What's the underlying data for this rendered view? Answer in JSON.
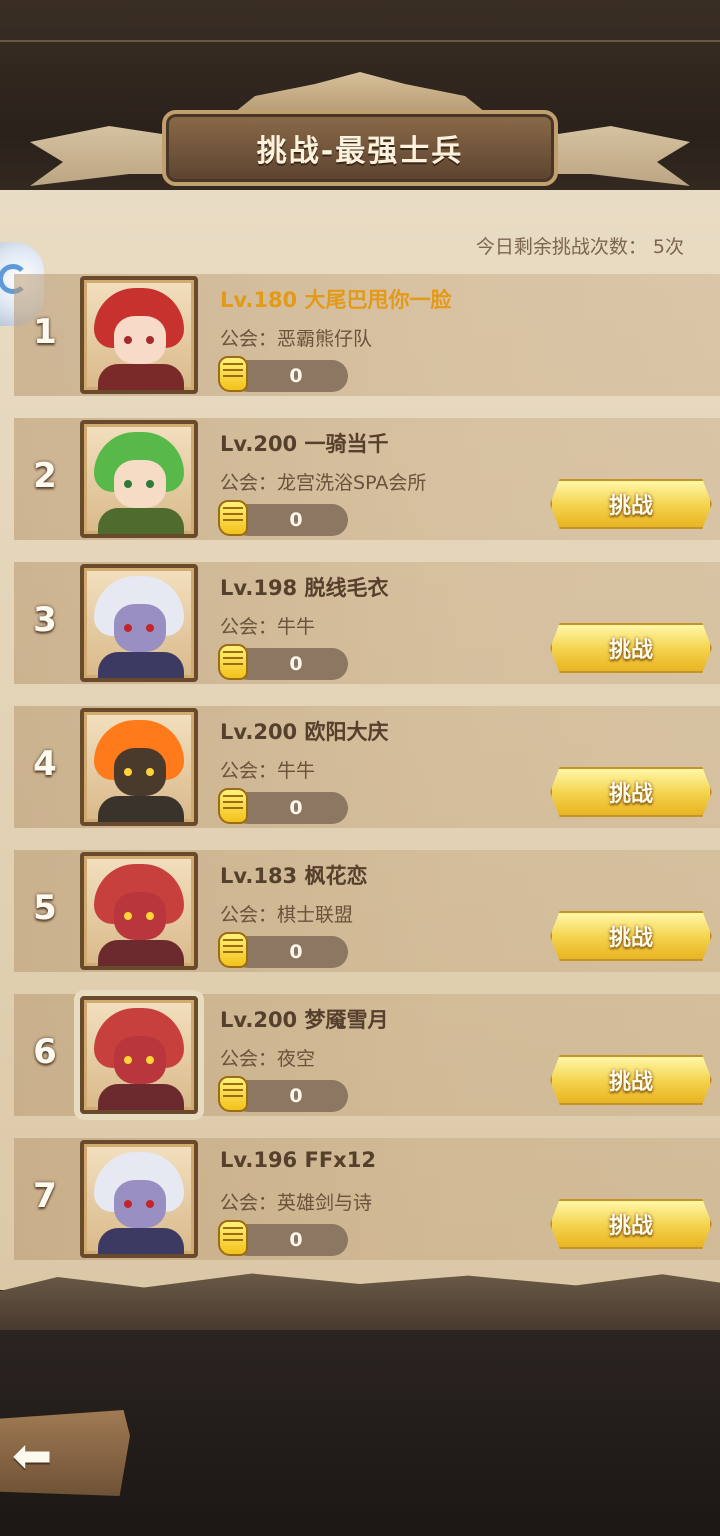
{
  "header": {
    "title": "挑战-最强士兵",
    "remaining_label": "今日剩余挑战次数：",
    "remaining_value": "5次"
  },
  "guild_prefix": "公会：",
  "challenge_label": "挑战",
  "rows": [
    {
      "rank": "1",
      "name": "Lv.180 大尾巴甩你一脸",
      "guild": "恶霸熊仔队",
      "power": "0",
      "portrait": "red-hair-horned-girl",
      "hair": "#c7322e",
      "skin": "#f7dac7",
      "body": "#7b2a2a",
      "eye": "#a52a2a"
    },
    {
      "rank": "2",
      "name": "Lv.200 一骑当千",
      "guild": "龙宫洗浴SPA会所",
      "power": "0",
      "portrait": "green-hair-flower-girl",
      "hair": "#59b84a",
      "skin": "#f6dcc5",
      "body": "#4f6b2d",
      "eye": "#2e7a3a"
    },
    {
      "rank": "3",
      "name": "Lv.198 脱线毛衣",
      "guild": "牛牛",
      "power": "0",
      "portrait": "white-hair-dark-elf",
      "hair": "#e6e9f2",
      "skin": "#9a8fc3",
      "body": "#3c3a63",
      "eye": "#c2262b"
    },
    {
      "rank": "4",
      "name": "Lv.200 欧阳大庆",
      "guild": "牛牛",
      "power": "0",
      "portrait": "fire-demon",
      "hair": "#ff7a1a",
      "skin": "#4a3a2c",
      "body": "#3a332c",
      "eye": "#ffd43a"
    },
    {
      "rank": "5",
      "name": "Lv.183 枫花恋",
      "guild": "棋士联盟",
      "power": "0",
      "portrait": "red-cyclops-beast",
      "hair": "#c8403e",
      "skin": "#b9363c",
      "body": "#6b2a2e",
      "eye": "#ffd43a"
    },
    {
      "rank": "6",
      "name": "Lv.200 梦魇雪月",
      "guild": "夜空",
      "power": "0",
      "portrait": "red-cyclops-beast-framed",
      "hair": "#c8403e",
      "skin": "#b9363c",
      "body": "#6b2a2e",
      "eye": "#ffd43a"
    },
    {
      "rank": "7",
      "name": "Lv.196 FFx12",
      "guild": "英雄剑与诗",
      "power": "0",
      "portrait": "white-hair-dark-elf",
      "hair": "#e6e9f2",
      "skin": "#9a8fc3",
      "body": "#3c3a63",
      "eye": "#c2262b"
    }
  ],
  "icons": {
    "back": "back-arrow-icon",
    "power": "fist-icon"
  },
  "colors": {
    "first_name": "#e39a18",
    "button": "#f3d24a",
    "parchment": "#e3d3b6"
  }
}
